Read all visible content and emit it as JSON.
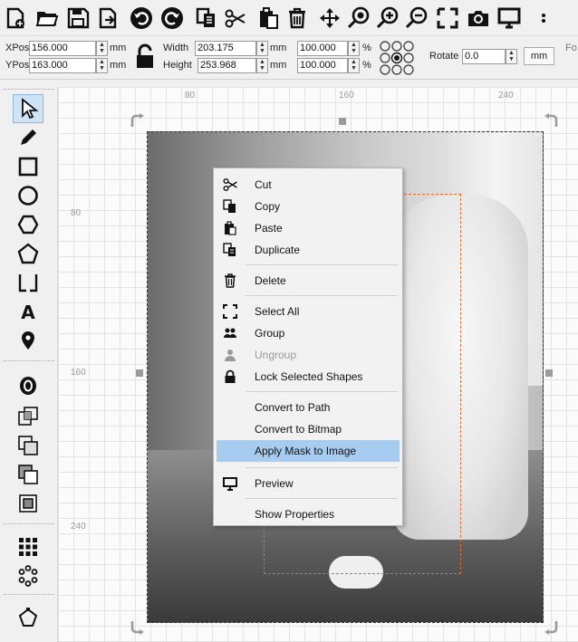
{
  "toolbar": {
    "icons": [
      "new-file-icon",
      "open-folder-icon",
      "save-icon",
      "import-icon",
      "undo-icon",
      "redo-icon",
      "copy-icon",
      "cut-icon",
      "paste-icon",
      "delete-icon",
      "move-icon",
      "zoom-icon",
      "zoom-in-icon",
      "zoom-out-icon",
      "select-all-icon",
      "camera-icon",
      "monitor-icon"
    ]
  },
  "props": {
    "xpos_label": "XPos",
    "xpos_value": "156.000",
    "ypos_label": "YPos",
    "ypos_value": "163.000",
    "unit": "mm",
    "width_label": "Width",
    "width_value": "203.175",
    "height_label": "Height",
    "height_value": "253.968",
    "scale_w": "100.000",
    "scale_h": "100.000",
    "percent": "%",
    "rotate_label": "Rotate",
    "rotate_value": "0.0",
    "mm_button": "mm",
    "font_partial": "Fo"
  },
  "ruler": {
    "top": [
      "80",
      "160",
      "240"
    ],
    "left": [
      "80",
      "160",
      "240"
    ]
  },
  "context_menu": {
    "items": [
      {
        "label": "Cut",
        "icon": "scissors-icon"
      },
      {
        "label": "Copy",
        "icon": "copy-icon"
      },
      {
        "label": "Paste",
        "icon": "clipboard-icon"
      },
      {
        "label": "Duplicate",
        "icon": "duplicate-icon"
      },
      {
        "label": "Delete",
        "icon": "trash-icon"
      },
      {
        "label": "Select All",
        "icon": "select-all-icon"
      },
      {
        "label": "Group",
        "icon": "group-icon"
      },
      {
        "label": "Ungroup",
        "icon": "ungroup-icon"
      },
      {
        "label": "Lock Selected Shapes",
        "icon": "lock-icon"
      },
      {
        "label": "Convert to Path"
      },
      {
        "label": "Convert to Bitmap"
      },
      {
        "label": "Apply Mask to Image"
      },
      {
        "label": "Preview",
        "icon": "monitor-icon"
      },
      {
        "label": "Show Properties"
      }
    ]
  },
  "colors": {
    "highlight": "#a8ccef",
    "mask_outline": "#e46b2e"
  }
}
